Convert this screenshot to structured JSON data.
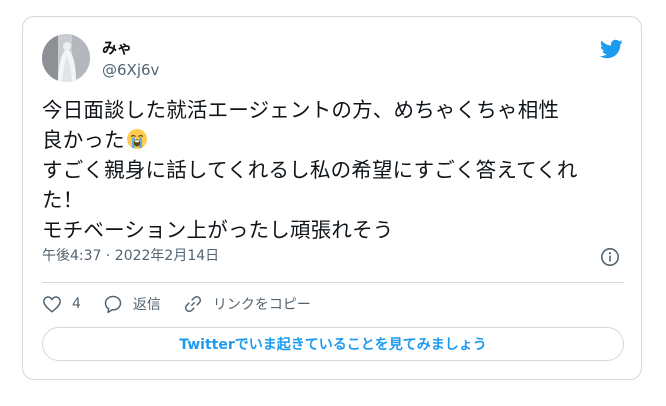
{
  "tweet": {
    "author": {
      "display_name": "みゃ",
      "handle": "@6Xj6v"
    },
    "text_lines": {
      "line1": "今日面談した就活エージェントの方、めちゃくちゃ相性",
      "line2": "良かった",
      "line3": "すごく親身に話してくれるし私の希望にすごく答えてくれ",
      "line4": "た！",
      "line5": "モチベーション上がったし頑張れそう"
    },
    "emoji": "crying-face-emoji",
    "timestamp": "午後4:37 · 2022年2月14日"
  },
  "actions": {
    "like_count": "4",
    "reply_label": "返信",
    "copy_link_label": "リンクをコピー"
  },
  "cta_label": "Twitterでいま起きていることを見てみましょう",
  "colors": {
    "accent": "#1d9bf0",
    "border": "#cfd9de",
    "secondary_text": "#536471",
    "primary_text": "#0f1419"
  },
  "icons": {
    "logo": "twitter-bird-icon",
    "info": "info-icon",
    "like": "heart-icon",
    "reply": "reply-bubble-icon",
    "copy_link": "link-icon"
  }
}
